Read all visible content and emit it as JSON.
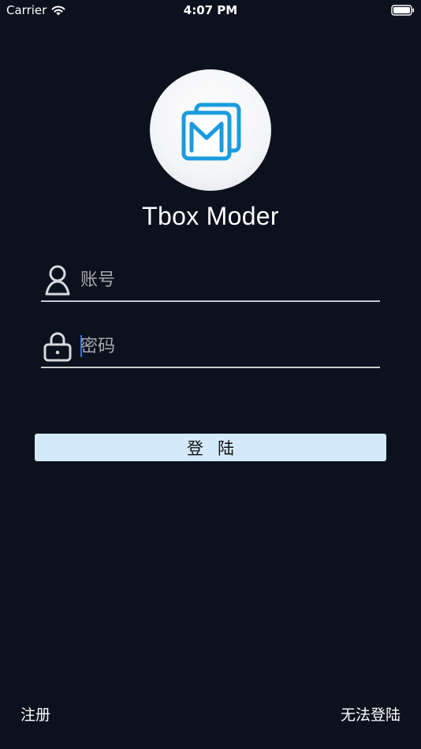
{
  "status_bar": {
    "carrier": "Carrier",
    "time": "4:07 PM"
  },
  "app": {
    "title": "Tbox Moder",
    "logo_icon": "mail-logo-icon",
    "logo_color": "#1a9be0"
  },
  "form": {
    "account_placeholder": "账号",
    "account_value": "",
    "password_placeholder": "密码",
    "password_value": "",
    "login_label": "登陆"
  },
  "links": {
    "register": "注册",
    "cant_login": "无法登陆"
  },
  "colors": {
    "background": "#0c111e",
    "button_bg": "#d4eafa",
    "caret": "#3a6cf0"
  }
}
